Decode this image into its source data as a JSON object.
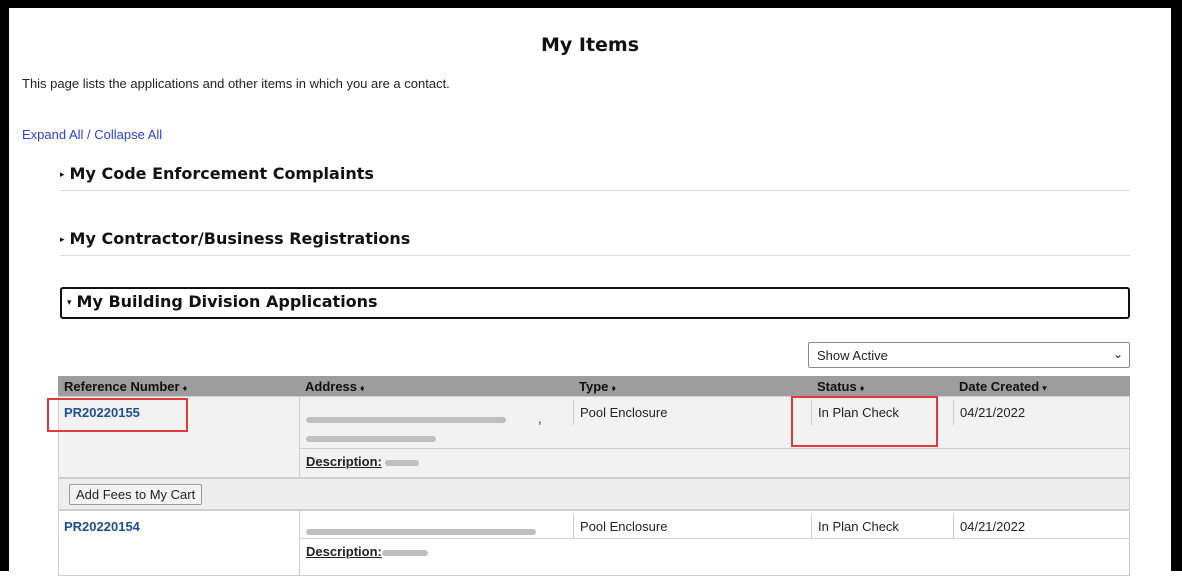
{
  "page": {
    "title": "My Items",
    "intro": "This page lists the applications and other items in which you are a contact.",
    "expand_collapse": "Expand All / Collapse All"
  },
  "sections": [
    {
      "label": "My Code Enforcement Complaints",
      "expanded": false
    },
    {
      "label": "My Contractor/Business Registrations",
      "expanded": false
    },
    {
      "label": "My Building Division Applications",
      "expanded": true
    }
  ],
  "filter": {
    "selected": "Show Active"
  },
  "table": {
    "columns": [
      "Reference Number",
      "Address",
      "Type",
      "Status",
      "Date Created"
    ],
    "rows": [
      {
        "reference": "PR20220155",
        "type": "Pool Enclosure",
        "status": "In Plan Check",
        "date_created": "04/21/2022",
        "description_label": "Description:"
      },
      {
        "reference": "PR20220154",
        "type": "Pool Enclosure",
        "status": "In Plan Check",
        "date_created": "04/21/2022",
        "description_label": "Description:"
      }
    ],
    "add_fees_label": "Add Fees to My Cart"
  },
  "colors": {
    "link": "#1f4f8f",
    "header_bg": "#9d9d9d",
    "highlight": "#e03a3a",
    "expand_link": "#2a3fd0"
  }
}
